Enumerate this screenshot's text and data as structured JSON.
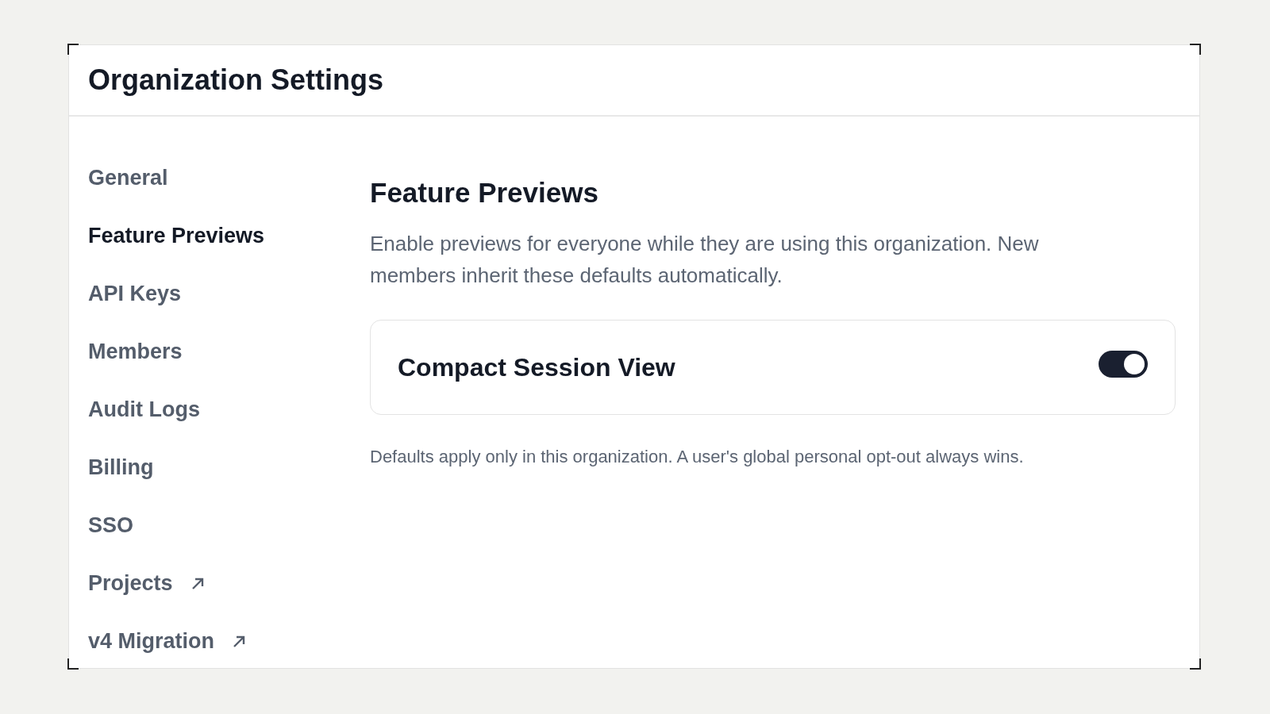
{
  "window": {
    "title": "Organization Settings"
  },
  "sidebar": {
    "items": [
      {
        "label": "General",
        "selected": false,
        "external": false
      },
      {
        "label": "Feature Previews",
        "selected": true,
        "external": false
      },
      {
        "label": "API Keys",
        "selected": false,
        "external": false
      },
      {
        "label": "Members",
        "selected": false,
        "external": false
      },
      {
        "label": "Audit Logs",
        "selected": false,
        "external": false
      },
      {
        "label": "Billing",
        "selected": false,
        "external": false
      },
      {
        "label": "SSO",
        "selected": false,
        "external": false
      },
      {
        "label": "Projects",
        "selected": false,
        "external": true
      },
      {
        "label": "v4 Migration",
        "selected": false,
        "external": true
      }
    ]
  },
  "content": {
    "heading": "Feature Previews",
    "description": "Enable previews for everyone while they are using this organization. New members inherit these defaults automatically.",
    "features": [
      {
        "label": "Compact Session View",
        "on": true
      }
    ],
    "note": "Defaults apply only in this organization. A user's global personal opt-out always wins."
  }
}
